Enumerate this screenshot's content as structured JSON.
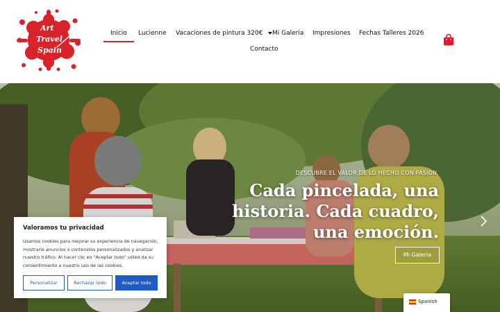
{
  "header": {
    "logo_lines": [
      "Art",
      "Travel",
      "Spain"
    ],
    "nav": [
      {
        "label": "Inicio",
        "active": true
      },
      {
        "label": "Lucienne"
      },
      {
        "label": "Vacaciones de pintura 320€",
        "has_dropdown": true
      },
      {
        "label": "Mi Galeria"
      },
      {
        "label": "Impresiones"
      },
      {
        "label": "Fechas Talleres 2026"
      },
      {
        "label": "Contacto"
      }
    ],
    "cart_icon": "shopping-bag-icon"
  },
  "hero": {
    "kicker": "DESCUBRE EL VALOR DE LO HECHO CON PASIÓN.",
    "title": "Cada pincelada, una historia. Cada cuadro, una emoción.",
    "button_label": "Mi Galeria",
    "next_icon": "chevron-right-icon"
  },
  "cookie": {
    "title": "Valoramos tu privacidad",
    "text": "Usamos cookies para mejorar su experiencia de navegación, mostrarle anuncios o contenidos personalizados y analizar nuestro tráfico. Al hacer clic en \"Aceptar todo\" usted da su consentimiento a nuestro uso de las cookies.",
    "buttons": {
      "customize": "Personalizar",
      "reject": "Rechazar todo",
      "accept": "Aceptar todo"
    }
  },
  "language": {
    "label": "Spanish",
    "flag_icon": "spain-flag-icon"
  },
  "colors": {
    "brand_red": "#d9232a",
    "cookie_blue": "#1e5bc6"
  }
}
